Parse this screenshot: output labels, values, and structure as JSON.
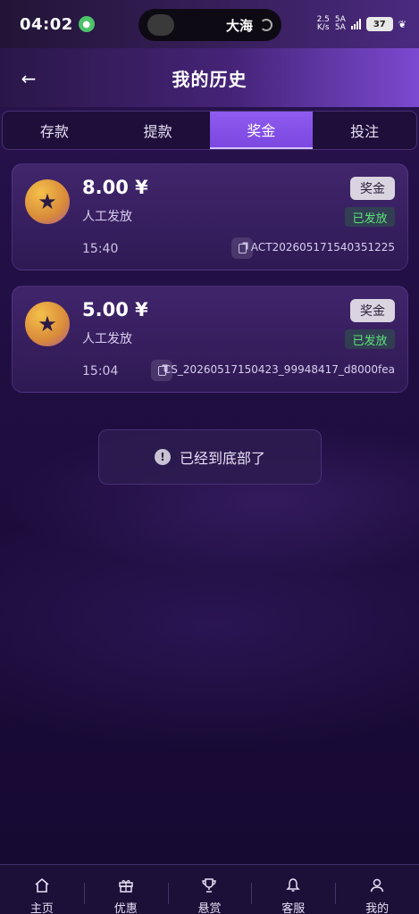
{
  "status_bar": {
    "time": "04:02",
    "island_text": "大海",
    "net_rate_top": "2.5",
    "net_rate_bottom": "K/s",
    "sim1": "5A",
    "sim2": "5A",
    "battery": "37"
  },
  "header": {
    "title": "我的历史"
  },
  "tabs": [
    {
      "label": "存款",
      "active": false
    },
    {
      "label": "提款",
      "active": false
    },
    {
      "label": "奖金",
      "active": true
    },
    {
      "label": "投注",
      "active": false
    }
  ],
  "records": [
    {
      "amount": "8.00 ¥",
      "method": "人工发放",
      "tag": "奖金",
      "status": "已发放",
      "time": "15:40",
      "order_id": "ACT202605171540351225"
    },
    {
      "amount": "5.00 ¥",
      "method": "人工发放",
      "tag": "奖金",
      "status": "已发放",
      "time": "15:04",
      "order_id": "CS_20260517150423_99948417_d8000fea"
    }
  ],
  "bottom_notice": "已经到底部了",
  "bottom_nav": [
    {
      "label": "主页",
      "icon": "home-icon"
    },
    {
      "label": "优惠",
      "icon": "gift-icon"
    },
    {
      "label": "悬赏",
      "icon": "trophy-icon"
    },
    {
      "label": "客服",
      "icon": "bell-icon"
    },
    {
      "label": "我的",
      "icon": "user-icon"
    }
  ],
  "colors": {
    "accent": "#8f5cf0",
    "status_green": "#5ee07a",
    "background": "#1a0b33"
  }
}
